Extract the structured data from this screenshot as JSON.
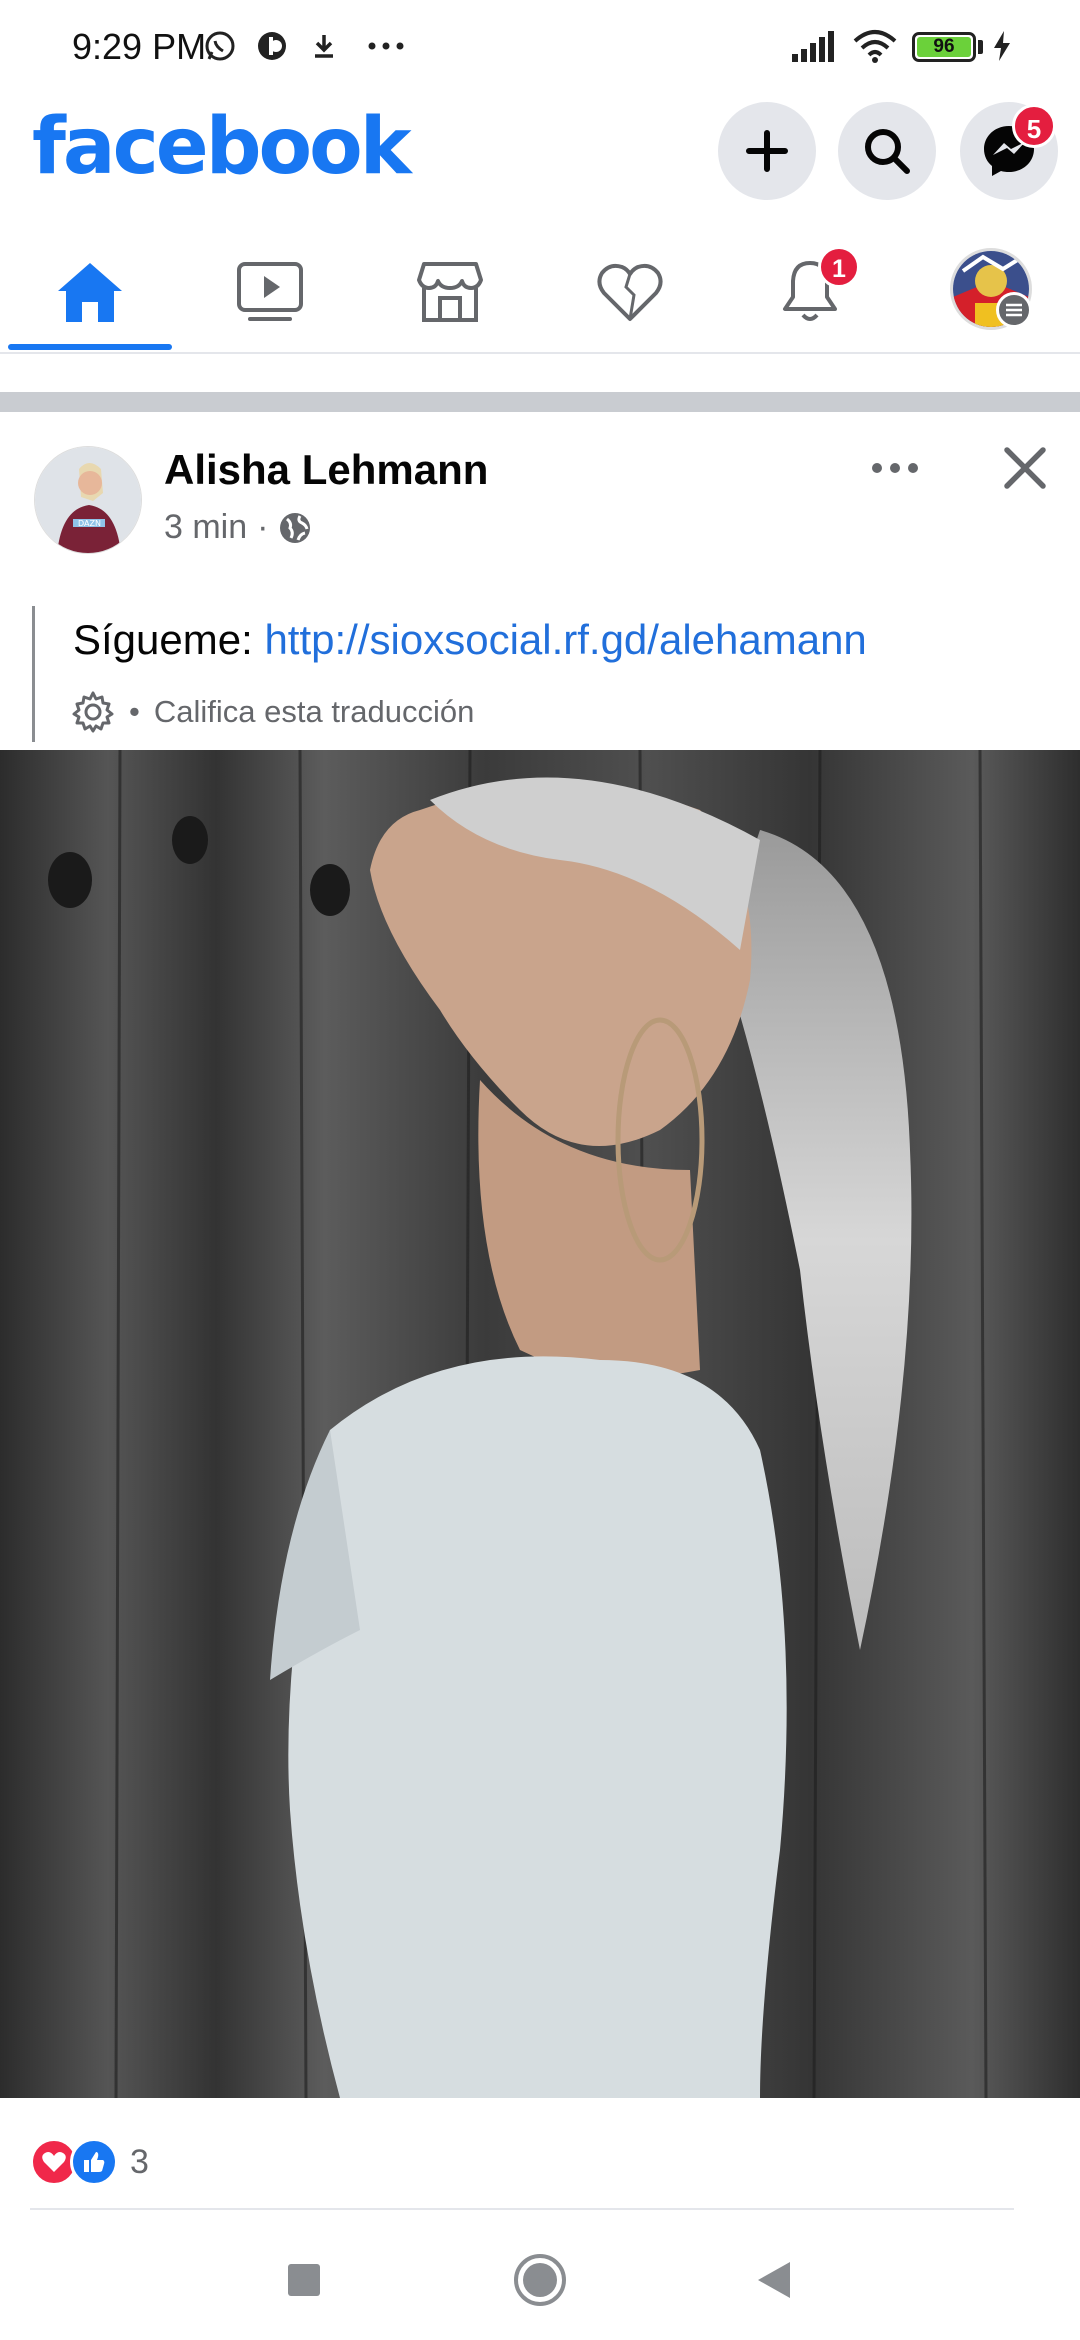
{
  "status_bar": {
    "time": "9:29 PM",
    "battery_level": "96",
    "icons": [
      "whatsapp-icon",
      "notification-app-icon",
      "download-icon",
      "more-dots-icon",
      "signal-icon",
      "wifi-icon",
      "battery-icon",
      "charging-icon"
    ]
  },
  "header": {
    "logo": "facebook",
    "messenger_badge": "5"
  },
  "tabs": [
    {
      "name": "home",
      "icon": "home-icon",
      "active": true
    },
    {
      "name": "watch",
      "icon": "video-icon",
      "active": false
    },
    {
      "name": "marketplace",
      "icon": "marketplace-icon",
      "active": false
    },
    {
      "name": "dating",
      "icon": "heart-icon",
      "active": false
    },
    {
      "name": "notifications",
      "icon": "bell-icon",
      "active": false,
      "badge": "1"
    },
    {
      "name": "menu",
      "icon": "profile-avatar",
      "active": false
    }
  ],
  "post": {
    "author": "Alisha Lehmann",
    "time": "3 min",
    "separator": "·",
    "text_prefix": "Sígueme: ",
    "link": "http://sioxsocial.rf.gd/alehamann",
    "rate_dot": "•",
    "rate_translation": "Califica esta traducción",
    "reaction_count": "3"
  },
  "colors": {
    "brand": "#1877f2",
    "badge": "#e41e3f",
    "link": "#216fdb",
    "secondary_text": "#65676b"
  }
}
